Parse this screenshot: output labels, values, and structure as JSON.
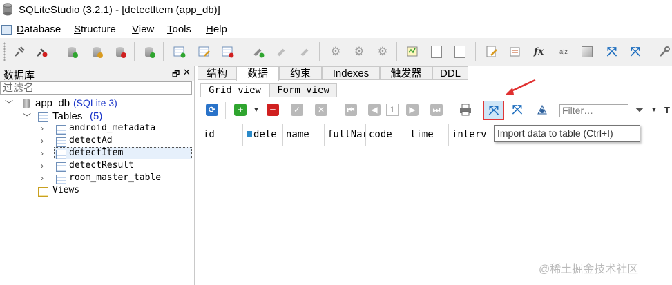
{
  "window": {
    "title": "SQLiteStudio (3.2.1) - [detectItem (app_db)]"
  },
  "menu": [
    "Database",
    "Structure",
    "View",
    "Tools",
    "Help"
  ],
  "toolbar": {
    "icons": [
      "connect-icon",
      "disconnect-icon",
      "add-database-icon",
      "edit-database-icon",
      "remove-database-icon",
      "refresh-database-icon",
      "create-table-icon",
      "edit-table-icon",
      "delete-table-icon",
      "add-column-icon",
      "edit-column-icon",
      "delete-column-icon",
      "create-index-icon",
      "create-trigger-icon",
      "create-view-icon",
      "sql-editor-icon",
      "ddl-history-icon",
      "functions-icon",
      "collations-icon",
      "extensions-icon",
      "import-icon",
      "export-icon",
      "config-icon"
    ],
    "fx_label": "fx",
    "az_label": "a|z"
  },
  "dock": {
    "title": "数据库",
    "float_glyph": "🗗",
    "close_glyph": "✕",
    "filter_placeholder": "过滤名",
    "tree": {
      "db_name": "app_db",
      "db_type": "(SQLite 3)",
      "tables_label": "Tables",
      "tables_count": "(5)",
      "tables": [
        "android_metadata",
        "detectAd",
        "detectItem",
        "detectResult",
        "room_master_table"
      ],
      "selected": "detectItem",
      "views_label": "Views"
    }
  },
  "tabs": [
    "结构",
    "数据",
    "约束",
    "Indexes",
    "触发器",
    "DDL"
  ],
  "active_tab": "数据",
  "subtabs": [
    "Grid view",
    "Form view"
  ],
  "active_subtab": "Grid view",
  "grid_toolbar": {
    "page": "1",
    "filter_placeholder": "Filter…"
  },
  "grid": {
    "columns": [
      "id",
      "dele",
      "name",
      "fullNar",
      "code",
      "time",
      "interv"
    ]
  },
  "tooltip": "Import data to table (Ctrl+I)",
  "watermark": "@稀土掘金技术社区",
  "colors": {
    "highlight_border": "#e03838",
    "accent_blue": "#1a35c9",
    "arrow_red": "#e03030"
  }
}
